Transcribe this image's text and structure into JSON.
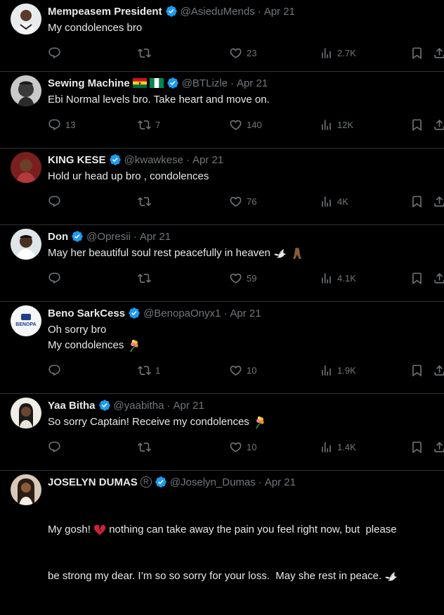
{
  "colors": {
    "background": "#000000",
    "text": "#e7e9ea",
    "muted": "#71767b",
    "verified": "#1d9bf0",
    "border": "#2f3336"
  },
  "icons": {
    "reply": "reply-icon",
    "retweet": "retweet-icon",
    "like": "heart-icon",
    "views": "views-icon",
    "bookmark": "bookmark-icon",
    "share": "share-icon",
    "verified": "verified-badge-icon"
  },
  "tweets": [
    {
      "name": "Mempeasem President",
      "handle": "@AsieduMends",
      "date": "Apr 21",
      "lines": [
        "My condolences bro"
      ],
      "replies": "",
      "retweets": "",
      "likes": "23",
      "views": "2.7K"
    },
    {
      "name": "Sewing Machine",
      "handle": "@BTLizle",
      "date": "Apr 21",
      "lines": [
        "Ebi Normal levels bro. Take heart and move on."
      ],
      "replies": "13",
      "retweets": "7",
      "likes": "140",
      "views": "12K"
    },
    {
      "name": "KING KESE",
      "handle": "@kwawkese",
      "date": "Apr 21",
      "lines": [
        "Hold ur head up bro , condolences"
      ],
      "replies": "",
      "retweets": "",
      "likes": "76",
      "views": "4K"
    },
    {
      "name": "Don",
      "handle": "@Opresii",
      "date": "Apr 21",
      "lines": [
        "May her beautiful soul rest peacefully in heaven"
      ],
      "replies": "",
      "retweets": "",
      "likes": "59",
      "views": "4.1K"
    },
    {
      "name": "Beno SarkCess",
      "handle": "@BenopaOnyx1",
      "date": "Apr 21",
      "lines": [
        "Oh sorry bro",
        "My condolences"
      ],
      "replies": "",
      "retweets": "1",
      "likes": "10",
      "views": "1.9K",
      "avatar_text": "BENOPA"
    },
    {
      "name": "Yaa Bitha",
      "handle": "@yaabitha",
      "date": "Apr 21",
      "lines": [
        "So sorry Captain! Receive my condolences"
      ],
      "replies": "",
      "retweets": "",
      "likes": "10",
      "views": "1.4K"
    },
    {
      "name": "JOSELYN DUMAS",
      "handle": "@Joselyn_Dumas",
      "date": "Apr 21",
      "lines": [
        "My gosh! ",
        " nothing can take away the pain you feel right now, but  please",
        "be strong my dear. I’m so so sorry for your loss.  May she rest in peace. "
      ],
      "registered_mark": "R"
    }
  ]
}
